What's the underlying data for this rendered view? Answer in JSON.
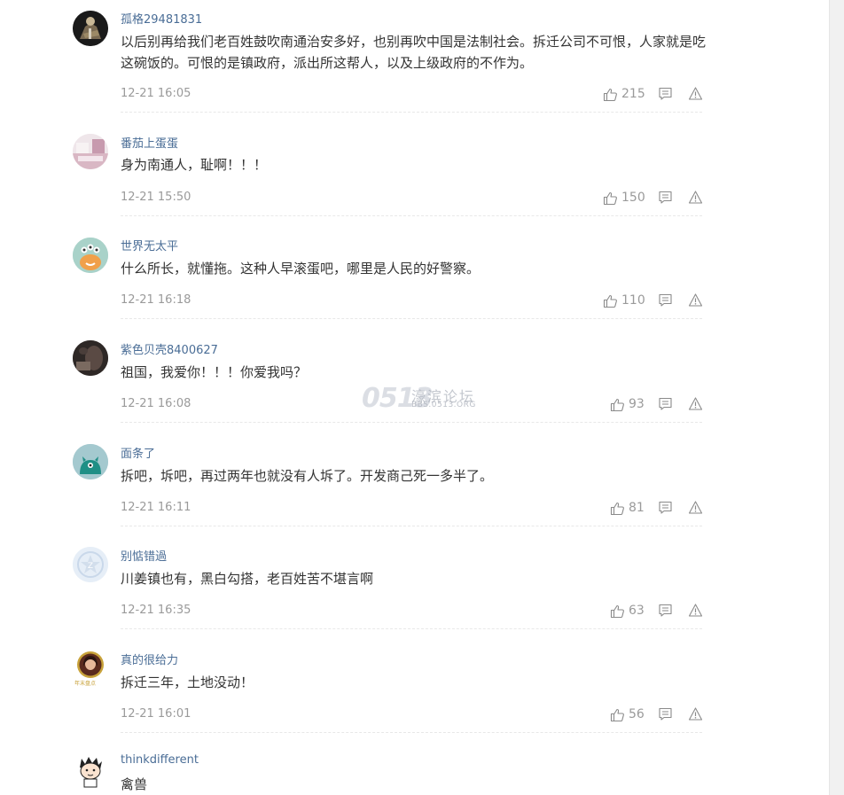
{
  "comments": [
    {
      "username": "孤格29481831",
      "text": "以后别再给我们老百姓鼓吹南通治安多好，也别再吹中国是法制社会。拆迁公司不可恨，人家就是吃这碗饭的。可恨的是镇政府，派出所这帮人，以及上级政府的不作为。",
      "time": "12-21 16:05",
      "likes": "215",
      "avatar": "knight-avatar"
    },
    {
      "username": "番茄上蛋蛋",
      "text": "身为南通人，耻啊！！！",
      "time": "12-21 15:50",
      "likes": "150",
      "avatar": "bedroom-photo-avatar"
    },
    {
      "username": "世界无太平",
      "text": "什么所长，就懂拖。这种人早滚蛋吧，哪里是人民的好警察。",
      "time": "12-21 16:18",
      "likes": "110",
      "avatar": "cartoon-alien-avatar"
    },
    {
      "username": "紫色贝壳8400627",
      "text": "祖国，我爱你！！！你爱我吗？",
      "time": "12-21 16:08",
      "likes": "93",
      "avatar": "dark-photo-avatar"
    },
    {
      "username": "面条了",
      "text": "拆吧，坼吧，再过两年也就没有人坼了。开发商己死一多半了。",
      "time": "12-21 16:11",
      "likes": "81",
      "avatar": "green-monster-avatar"
    },
    {
      "username": "别惦错過",
      "text": "川姜镇也有，黑白勾搭，老百姓苦不堪言啊",
      "time": "12-21 16:35",
      "likes": "63",
      "avatar": "default-star-avatar"
    },
    {
      "username": "真的很给力",
      "text": "拆迁三年，土地没动！",
      "time": "12-21 16:01",
      "likes": "56",
      "avatar": "portrait-badge-avatar",
      "badge": "年末盘点"
    },
    {
      "username": "thinkdifferent",
      "text": "禽兽",
      "time": "",
      "likes": "",
      "avatar": "cartoon-boy-avatar"
    }
  ],
  "watermark": {
    "logo": "0513",
    "name": "濠滨论坛",
    "url": "BBS.0513.ORG"
  },
  "colors": {
    "username": "#4a6d96",
    "text": "#333333",
    "meta": "#9a9a9a"
  }
}
